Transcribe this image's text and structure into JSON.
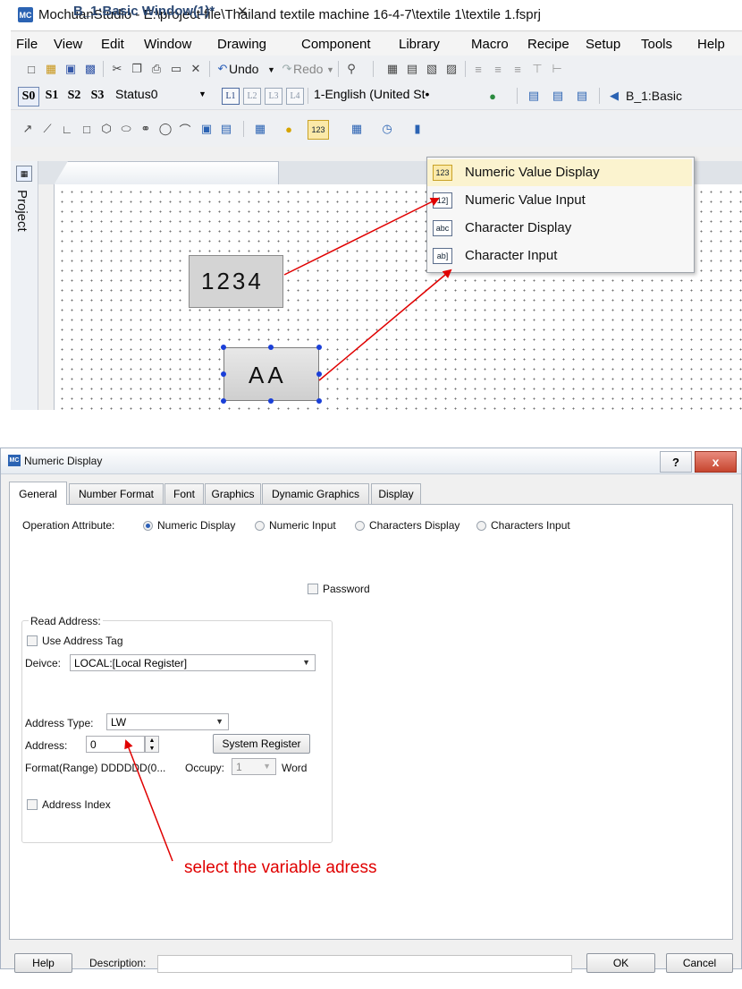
{
  "top_window": {
    "title": "MochuanStudio - E:\\project file\\Thailand textile machine 16-4-7\\textile 1\\textile 1.fsprj",
    "app_icon_text": "MC",
    "menu": [
      "File",
      "View",
      "Edit",
      "Window",
      "Drawing",
      "Component",
      "Library",
      "Macro",
      "Recipe",
      "Setup",
      "Tools",
      "Help"
    ],
    "toolbar1": {
      "undo_label": "Undo",
      "redo_label": "Redo"
    },
    "toolbar2": {
      "status_buttons": [
        "S0",
        "S1",
        "S2",
        "S3"
      ],
      "status_combo": "Status0",
      "layer_buttons": [
        "L1",
        "L2",
        "L3",
        "L4"
      ],
      "language_combo": "1-English (United St•",
      "window_combo": "B_1:Basic"
    },
    "project_panel_label": "Project",
    "document_tab": "B_1:Basic Window(1)*",
    "canvas": {
      "numeric_widget_text": "1234",
      "character_widget_text": "AA"
    },
    "dropdown": [
      {
        "icon": "123",
        "label": "Numeric Value Display"
      },
      {
        "icon": "12]",
        "label": "Numeric Value Input"
      },
      {
        "icon": "abc",
        "label": "Character Display"
      },
      {
        "icon": "ab]",
        "label": "Character Input"
      }
    ],
    "toolbar3_numeric_icon": "123"
  },
  "dialog": {
    "title": "Numeric Display",
    "icon_text": "MC",
    "help_symbol": "?",
    "close_symbol": "x",
    "tabs": [
      "General",
      "Number Format",
      "Font",
      "Graphics",
      "Dynamic Graphics",
      "Display"
    ],
    "active_tab": "General",
    "operation_attribute_label": "Operation Attribute:",
    "operation_options": [
      "Numeric Display",
      "Numeric Input",
      "Characters Display",
      "Characters Input"
    ],
    "selected_operation": "Numeric Display",
    "password_label": "Password",
    "read_address": {
      "group_label": "Read Address:",
      "use_address_tag_label": "Use Address Tag",
      "device_label": "Deivce:",
      "device_value": "LOCAL:[Local Register]",
      "address_type_label": "Address Type:",
      "address_type_value": "LW",
      "address_label": "Address:",
      "address_value": "0",
      "system_register_button": "System Register",
      "format_label": "Format(Range) DDDDDD(0...",
      "occupy_label": "Occupy:",
      "occupy_value": "1",
      "word_label": "Word",
      "address_index_label": "Address Index"
    },
    "annotation": "select the variable adress",
    "footer": {
      "help_button": "Help",
      "description_label": "Description:",
      "ok_button": "OK",
      "cancel_button": "Cancel"
    }
  },
  "colors": {
    "annotation_red": "#e00000",
    "selection_handle": "#1a3fd8",
    "dropdown_highlight": "#fbf3cf",
    "close_button": "#c6452e"
  }
}
